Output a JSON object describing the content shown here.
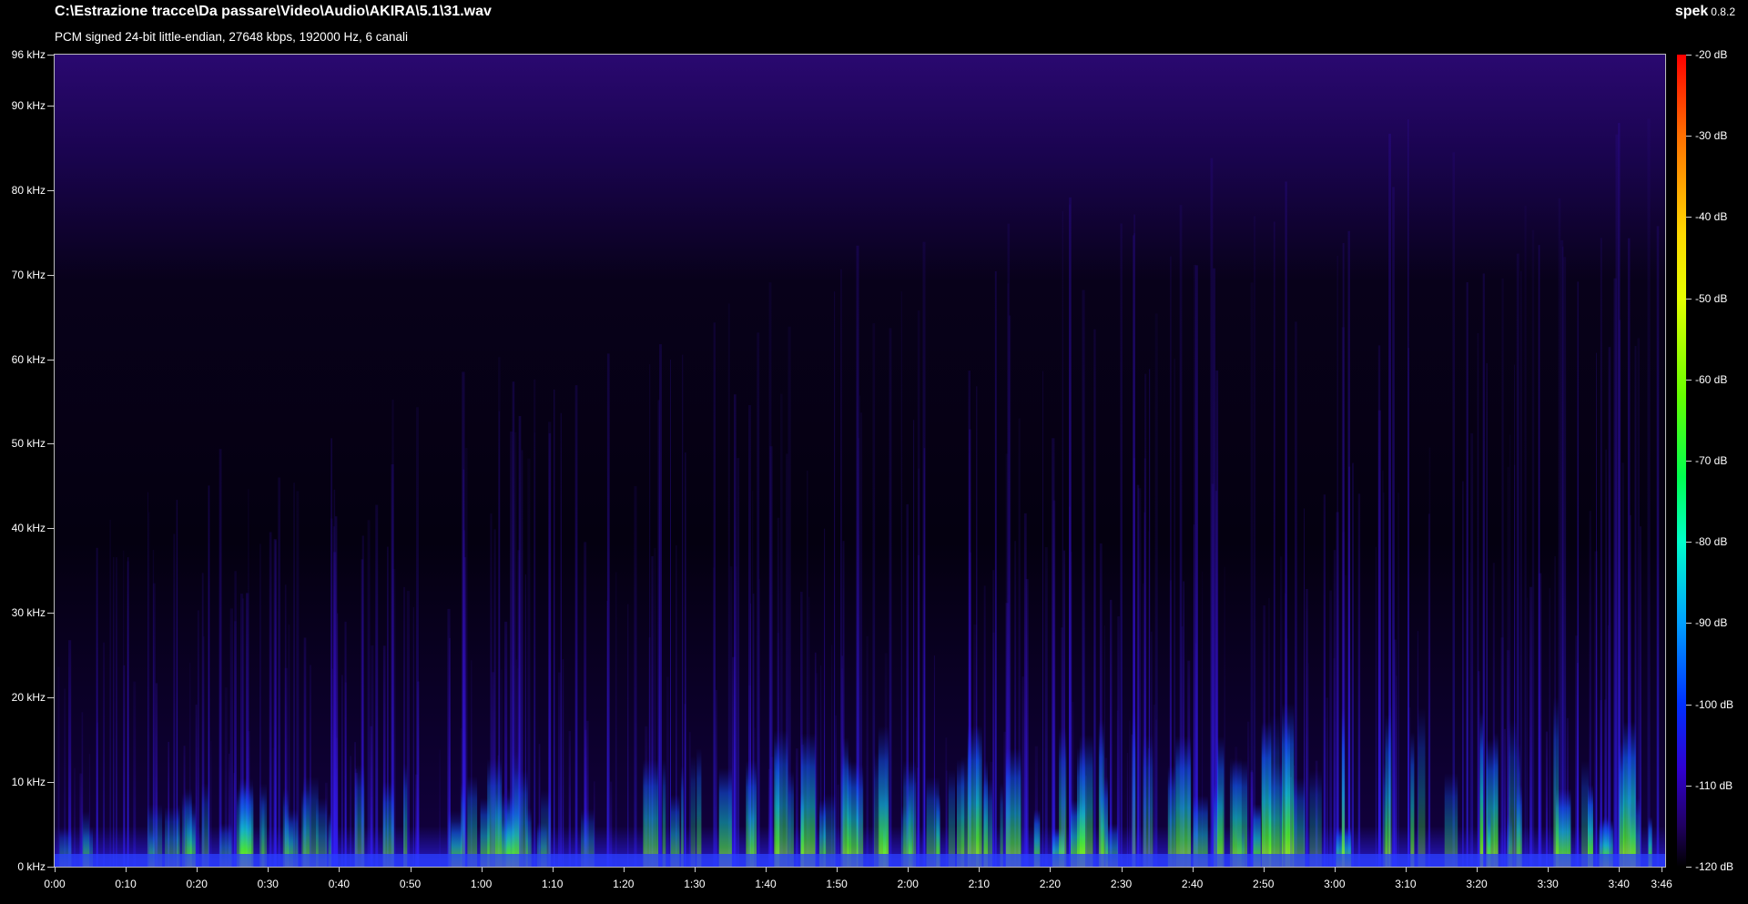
{
  "header": {
    "file_path": "C:\\Estrazione tracce\\Da passare\\Video\\Audio\\AKIRA\\5.1\\31.wav",
    "stream_info": "PCM signed 24-bit little-endian, 27648 kbps, 192000 Hz, 6 canali",
    "app_name": "spek",
    "app_version": "0.8.2"
  },
  "spectrogram": {
    "freq_axis_labels": [
      "96 kHz",
      "90 kHz",
      "80 kHz",
      "70 kHz",
      "60 kHz",
      "50 kHz",
      "40 kHz",
      "30 kHz",
      "20 kHz",
      "10 kHz",
      "0 kHz"
    ],
    "freq_axis_values_khz": [
      96,
      90,
      80,
      70,
      60,
      50,
      40,
      30,
      20,
      10,
      0
    ],
    "freq_range_khz": [
      0,
      96
    ],
    "time_axis_labels": [
      "0:00",
      "0:10",
      "0:20",
      "0:30",
      "0:40",
      "0:50",
      "1:00",
      "1:10",
      "1:20",
      "1:30",
      "1:40",
      "1:50",
      "2:00",
      "2:10",
      "2:20",
      "2:30",
      "2:40",
      "2:50",
      "3:00",
      "3:10",
      "3:20",
      "3:30",
      "3:40",
      "3:46"
    ],
    "time_axis_values_s": [
      0,
      10,
      20,
      30,
      40,
      50,
      60,
      70,
      80,
      90,
      100,
      110,
      120,
      130,
      140,
      150,
      160,
      170,
      180,
      190,
      200,
      210,
      220,
      226
    ],
    "duration_s": 226.5
  },
  "colorbar": {
    "labels": [
      "-20 dB",
      "-30 dB",
      "-40 dB",
      "-50 dB",
      "-60 dB",
      "-70 dB",
      "-80 dB",
      "-90 dB",
      "-100 dB",
      "-110 dB",
      "-120 dB"
    ],
    "values_db": [
      -20,
      -30,
      -40,
      -50,
      -60,
      -70,
      -80,
      -90,
      -100,
      -110,
      -120
    ],
    "colors": {
      "max": "#ff0000",
      "high": "#ffd800",
      "mid": "#00ff50",
      "low": "#0030ff",
      "floor": "#000000"
    }
  }
}
